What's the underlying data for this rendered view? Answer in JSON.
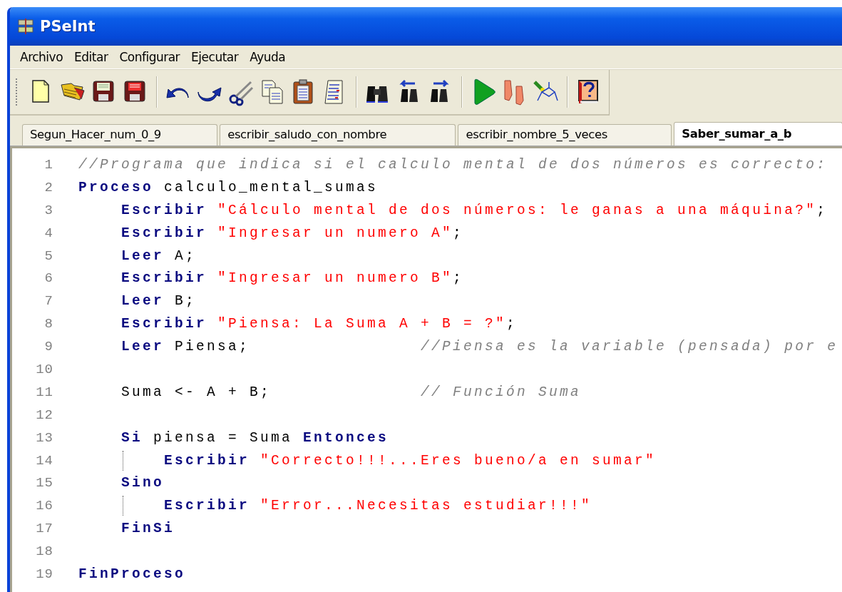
{
  "window": {
    "title": "PSeInt"
  },
  "menu": [
    "Archivo",
    "Editar",
    "Configurar",
    "Ejecutar",
    "Ayuda"
  ],
  "tabs": [
    {
      "label": "Segun_Hacer_num_0_9",
      "selected": false
    },
    {
      "label": "escribir_saludo_con_nombre",
      "selected": false
    },
    {
      "label": "escribir_nombre_5_veces",
      "selected": false
    },
    {
      "label": "Saber_sumar_a_b",
      "selected": true
    }
  ],
  "editor": {
    "lines": [
      {
        "number": "1",
        "guide": false,
        "tokens": [
          {
            "kind": "comment",
            "text": "//Programa que indica si el calculo mental de dos números es correcto:"
          }
        ]
      },
      {
        "number": "2",
        "guide": false,
        "tokens": [
          {
            "kind": "keyword",
            "text": "Proceso"
          },
          {
            "kind": "plain",
            "text": " calculo_mental_sumas"
          }
        ]
      },
      {
        "number": "3",
        "guide": false,
        "tokens": [
          {
            "kind": "keyword",
            "text": "    Escribir "
          },
          {
            "kind": "string",
            "text": "\"Cálculo mental de dos números: le ganas a una máquina?\""
          },
          {
            "kind": "plain",
            "text": ";"
          }
        ]
      },
      {
        "number": "4",
        "guide": false,
        "tokens": [
          {
            "kind": "keyword",
            "text": "    Escribir "
          },
          {
            "kind": "string",
            "text": "\"Ingresar un numero A\""
          },
          {
            "kind": "plain",
            "text": ";"
          }
        ]
      },
      {
        "number": "5",
        "guide": false,
        "tokens": [
          {
            "kind": "keyword",
            "text": "    Leer"
          },
          {
            "kind": "plain",
            "text": " A;"
          }
        ]
      },
      {
        "number": "6",
        "guide": false,
        "tokens": [
          {
            "kind": "keyword",
            "text": "    Escribir "
          },
          {
            "kind": "string",
            "text": "\"Ingresar un numero B\""
          },
          {
            "kind": "plain",
            "text": ";"
          }
        ]
      },
      {
        "number": "7",
        "guide": false,
        "tokens": [
          {
            "kind": "keyword",
            "text": "    Leer"
          },
          {
            "kind": "plain",
            "text": " B;"
          }
        ]
      },
      {
        "number": "8",
        "guide": false,
        "tokens": [
          {
            "kind": "keyword",
            "text": "    Escribir "
          },
          {
            "kind": "string",
            "text": "\"Piensa: La Suma A + B = ?\""
          },
          {
            "kind": "plain",
            "text": ";"
          }
        ]
      },
      {
        "number": "9",
        "guide": false,
        "tokens": [
          {
            "kind": "keyword",
            "text": "    Leer"
          },
          {
            "kind": "plain",
            "text": " Piensa;                "
          },
          {
            "kind": "comment",
            "text": "//Piensa es la variable (pensada) por e"
          }
        ]
      },
      {
        "number": "10",
        "guide": false
      },
      {
        "number": "11",
        "guide": false,
        "tokens": [
          {
            "kind": "plain",
            "text": "    Suma <- A + B;              "
          },
          {
            "kind": "comment",
            "text": "// Función Suma"
          }
        ]
      },
      {
        "number": "12",
        "guide": false
      },
      {
        "number": "13",
        "guide": false,
        "tokens": [
          {
            "kind": "keyword",
            "text": "    Si"
          },
          {
            "kind": "plain",
            "text": " piensa = Suma "
          },
          {
            "kind": "keyword",
            "text": "Entonces"
          }
        ]
      },
      {
        "number": "14",
        "guide": true,
        "tokens": [
          {
            "kind": "keyword",
            "text": "        Escribir "
          },
          {
            "kind": "string",
            "text": "\"Correcto!!!...Eres bueno/a en sumar\""
          }
        ]
      },
      {
        "number": "15",
        "guide": false,
        "tokens": [
          {
            "kind": "keyword",
            "text": "    Sino"
          }
        ]
      },
      {
        "number": "16",
        "guide": true,
        "tokens": [
          {
            "kind": "keyword",
            "text": "        Escribir "
          },
          {
            "kind": "string",
            "text": "\"Error...Necesitas estudiar!!!\""
          }
        ]
      },
      {
        "number": "17",
        "guide": false,
        "tokens": [
          {
            "kind": "keyword",
            "text": "    FinSi"
          }
        ]
      },
      {
        "number": "18",
        "guide": false
      },
      {
        "number": "19",
        "guide": false,
        "tokens": [
          {
            "kind": "keyword",
            "text": "FinProceso"
          }
        ]
      }
    ]
  }
}
